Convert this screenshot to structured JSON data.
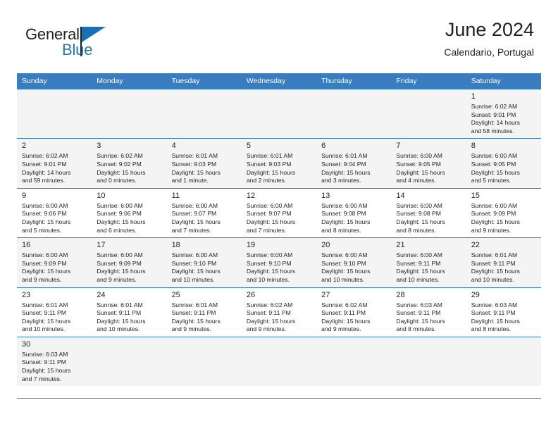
{
  "brand": {
    "name_part1": "General",
    "name_part2": "Blue",
    "flag_icon": "triangle-flag-icon",
    "accent_color": "#2175ba"
  },
  "header": {
    "title": "June 2024",
    "subtitle": "Calendario, Portugal"
  },
  "colors": {
    "header_row_bg": "#3a7cc0",
    "header_row_text": "#ffffff",
    "row_shaded_bg": "#f4f4f4",
    "row_plain_bg": "#ffffff",
    "text": "#231f20",
    "rule": "#3a7cc0"
  },
  "weekday_headers": [
    "Sunday",
    "Monday",
    "Tuesday",
    "Wednesday",
    "Thursday",
    "Friday",
    "Saturday"
  ],
  "weeks": [
    {
      "shaded": true,
      "days": [
        {
          "empty": true
        },
        {
          "empty": true
        },
        {
          "empty": true
        },
        {
          "empty": true
        },
        {
          "empty": true
        },
        {
          "empty": true
        },
        {
          "day": "1",
          "sunrise": "Sunrise: 6:02 AM",
          "sunset": "Sunset: 9:01 PM",
          "daylight_line1": "Daylight: 14 hours",
          "daylight_line2": "and 58 minutes."
        }
      ]
    },
    {
      "shaded": true,
      "days": [
        {
          "day": "2",
          "sunrise": "Sunrise: 6:02 AM",
          "sunset": "Sunset: 9:01 PM",
          "daylight_line1": "Daylight: 14 hours",
          "daylight_line2": "and 59 minutes."
        },
        {
          "day": "3",
          "sunrise": "Sunrise: 6:02 AM",
          "sunset": "Sunset: 9:02 PM",
          "daylight_line1": "Daylight: 15 hours",
          "daylight_line2": "and 0 minutes."
        },
        {
          "day": "4",
          "sunrise": "Sunrise: 6:01 AM",
          "sunset": "Sunset: 9:03 PM",
          "daylight_line1": "Daylight: 15 hours",
          "daylight_line2": "and 1 minute."
        },
        {
          "day": "5",
          "sunrise": "Sunrise: 6:01 AM",
          "sunset": "Sunset: 9:03 PM",
          "daylight_line1": "Daylight: 15 hours",
          "daylight_line2": "and 2 minutes."
        },
        {
          "day": "6",
          "sunrise": "Sunrise: 6:01 AM",
          "sunset": "Sunset: 9:04 PM",
          "daylight_line1": "Daylight: 15 hours",
          "daylight_line2": "and 3 minutes."
        },
        {
          "day": "7",
          "sunrise": "Sunrise: 6:00 AM",
          "sunset": "Sunset: 9:05 PM",
          "daylight_line1": "Daylight: 15 hours",
          "daylight_line2": "and 4 minutes."
        },
        {
          "day": "8",
          "sunrise": "Sunrise: 6:00 AM",
          "sunset": "Sunset: 9:05 PM",
          "daylight_line1": "Daylight: 15 hours",
          "daylight_line2": "and 5 minutes."
        }
      ]
    },
    {
      "shaded": false,
      "days": [
        {
          "day": "9",
          "sunrise": "Sunrise: 6:00 AM",
          "sunset": "Sunset: 9:06 PM",
          "daylight_line1": "Daylight: 15 hours",
          "daylight_line2": "and 5 minutes."
        },
        {
          "day": "10",
          "sunrise": "Sunrise: 6:00 AM",
          "sunset": "Sunset: 9:06 PM",
          "daylight_line1": "Daylight: 15 hours",
          "daylight_line2": "and 6 minutes."
        },
        {
          "day": "11",
          "sunrise": "Sunrise: 6:00 AM",
          "sunset": "Sunset: 9:07 PM",
          "daylight_line1": "Daylight: 15 hours",
          "daylight_line2": "and 7 minutes."
        },
        {
          "day": "12",
          "sunrise": "Sunrise: 6:00 AM",
          "sunset": "Sunset: 9:07 PM",
          "daylight_line1": "Daylight: 15 hours",
          "daylight_line2": "and 7 minutes."
        },
        {
          "day": "13",
          "sunrise": "Sunrise: 6:00 AM",
          "sunset": "Sunset: 9:08 PM",
          "daylight_line1": "Daylight: 15 hours",
          "daylight_line2": "and 8 minutes."
        },
        {
          "day": "14",
          "sunrise": "Sunrise: 6:00 AM",
          "sunset": "Sunset: 9:08 PM",
          "daylight_line1": "Daylight: 15 hours",
          "daylight_line2": "and 8 minutes."
        },
        {
          "day": "15",
          "sunrise": "Sunrise: 6:00 AM",
          "sunset": "Sunset: 9:09 PM",
          "daylight_line1": "Daylight: 15 hours",
          "daylight_line2": "and 9 minutes."
        }
      ]
    },
    {
      "shaded": true,
      "days": [
        {
          "day": "16",
          "sunrise": "Sunrise: 6:00 AM",
          "sunset": "Sunset: 9:09 PM",
          "daylight_line1": "Daylight: 15 hours",
          "daylight_line2": "and 9 minutes."
        },
        {
          "day": "17",
          "sunrise": "Sunrise: 6:00 AM",
          "sunset": "Sunset: 9:09 PM",
          "daylight_line1": "Daylight: 15 hours",
          "daylight_line2": "and 9 minutes."
        },
        {
          "day": "18",
          "sunrise": "Sunrise: 6:00 AM",
          "sunset": "Sunset: 9:10 PM",
          "daylight_line1": "Daylight: 15 hours",
          "daylight_line2": "and 10 minutes."
        },
        {
          "day": "19",
          "sunrise": "Sunrise: 6:00 AM",
          "sunset": "Sunset: 9:10 PM",
          "daylight_line1": "Daylight: 15 hours",
          "daylight_line2": "and 10 minutes."
        },
        {
          "day": "20",
          "sunrise": "Sunrise: 6:00 AM",
          "sunset": "Sunset: 9:10 PM",
          "daylight_line1": "Daylight: 15 hours",
          "daylight_line2": "and 10 minutes."
        },
        {
          "day": "21",
          "sunrise": "Sunrise: 6:00 AM",
          "sunset": "Sunset: 9:11 PM",
          "daylight_line1": "Daylight: 15 hours",
          "daylight_line2": "and 10 minutes."
        },
        {
          "day": "22",
          "sunrise": "Sunrise: 6:01 AM",
          "sunset": "Sunset: 9:11 PM",
          "daylight_line1": "Daylight: 15 hours",
          "daylight_line2": "and 10 minutes."
        }
      ]
    },
    {
      "shaded": false,
      "days": [
        {
          "day": "23",
          "sunrise": "Sunrise: 6:01 AM",
          "sunset": "Sunset: 9:11 PM",
          "daylight_line1": "Daylight: 15 hours",
          "daylight_line2": "and 10 minutes."
        },
        {
          "day": "24",
          "sunrise": "Sunrise: 6:01 AM",
          "sunset": "Sunset: 9:11 PM",
          "daylight_line1": "Daylight: 15 hours",
          "daylight_line2": "and 10 minutes."
        },
        {
          "day": "25",
          "sunrise": "Sunrise: 6:01 AM",
          "sunset": "Sunset: 9:11 PM",
          "daylight_line1": "Daylight: 15 hours",
          "daylight_line2": "and 9 minutes."
        },
        {
          "day": "26",
          "sunrise": "Sunrise: 6:02 AM",
          "sunset": "Sunset: 9:11 PM",
          "daylight_line1": "Daylight: 15 hours",
          "daylight_line2": "and 9 minutes."
        },
        {
          "day": "27",
          "sunrise": "Sunrise: 6:02 AM",
          "sunset": "Sunset: 9:11 PM",
          "daylight_line1": "Daylight: 15 hours",
          "daylight_line2": "and 9 minutes."
        },
        {
          "day": "28",
          "sunrise": "Sunrise: 6:03 AM",
          "sunset": "Sunset: 9:11 PM",
          "daylight_line1": "Daylight: 15 hours",
          "daylight_line2": "and 8 minutes."
        },
        {
          "day": "29",
          "sunrise": "Sunrise: 6:03 AM",
          "sunset": "Sunset: 9:11 PM",
          "daylight_line1": "Daylight: 15 hours",
          "daylight_line2": "and 8 minutes."
        }
      ]
    },
    {
      "shaded": true,
      "days": [
        {
          "day": "30",
          "sunrise": "Sunrise: 6:03 AM",
          "sunset": "Sunset: 9:11 PM",
          "daylight_line1": "Daylight: 15 hours",
          "daylight_line2": "and 7 minutes."
        },
        {
          "empty": true
        },
        {
          "empty": true
        },
        {
          "empty": true
        },
        {
          "empty": true
        },
        {
          "empty": true
        },
        {
          "empty": true
        }
      ]
    }
  ]
}
